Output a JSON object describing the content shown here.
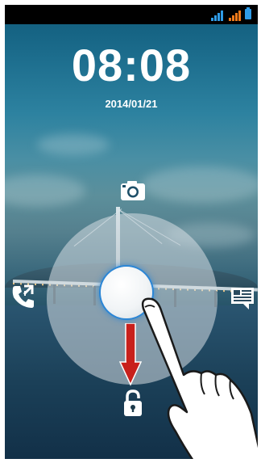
{
  "lock_screen": {
    "time": "08:08",
    "date": "2014/01/21"
  },
  "status_bar": {
    "signal_1_color": "#2f9be6",
    "signal_2_color": "#f07a1a",
    "battery_color": "#2f9be6"
  },
  "shortcuts": {
    "top": "camera-icon",
    "left": "phone-icon",
    "right": "message-icon",
    "bottom": "unlock-icon"
  },
  "gesture": {
    "arrow_color": "#c8201c",
    "direction": "down"
  }
}
